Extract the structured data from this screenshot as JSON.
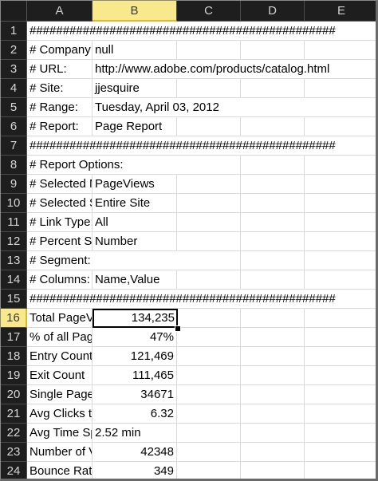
{
  "columns": [
    "A",
    "B",
    "C",
    "D",
    "E"
  ],
  "selected_cell": "B16",
  "rows": [
    {
      "num": "1",
      "a": "##############################################",
      "b": "",
      "span": true
    },
    {
      "num": "2",
      "a": "# Company:",
      "b": "null"
    },
    {
      "num": "3",
      "a": "# URL:",
      "b": "http://www.adobe.com/products/catalog.html"
    },
    {
      "num": "4",
      "a": "# Site:",
      "b": "jjesquire"
    },
    {
      "num": "5",
      "a": "# Range:",
      "b": "Tuesday, April 03, 2012"
    },
    {
      "num": "6",
      "a": "# Report:",
      "b": "Page Report"
    },
    {
      "num": "7",
      "a": "##############################################",
      "b": "",
      "span": true
    },
    {
      "num": "8",
      "a": "# Report Options:",
      "b": "",
      "spanA": true
    },
    {
      "num": "9",
      "a": "# Selected Metric:",
      "b": "PageViews"
    },
    {
      "num": "10",
      "a": "# Selected Segment:",
      "b": "Entire Site"
    },
    {
      "num": "11",
      "a": "# Link Type:",
      "b": "All"
    },
    {
      "num": "12",
      "a": "# Percent Shown as:",
      "b": "Number"
    },
    {
      "num": "13",
      "a": "# Segment:",
      "b": "",
      "spanA": true
    },
    {
      "num": "14",
      "a": "# Columns:",
      "b": "Name,Value"
    },
    {
      "num": "15",
      "a": "##############################################",
      "b": "",
      "span": true
    },
    {
      "num": "16",
      "a": "Total PageViews",
      "b": "134,235",
      "num_b": true
    },
    {
      "num": "17",
      "a": "% of all PageViews",
      "b": "47%",
      "num_b": true
    },
    {
      "num": "18",
      "a": "Entry Count",
      "b": "121,469",
      "num_b": true
    },
    {
      "num": "19",
      "a": "Exit Count",
      "b": "111,465",
      "num_b": true
    },
    {
      "num": "20",
      "a": "Single Page Visits",
      "b": "34671",
      "num_b": true
    },
    {
      "num": "21",
      "a": "Avg Clicks to Page",
      "b": "6.32",
      "num_b": true
    },
    {
      "num": "22",
      "a": "Avg Time Spent",
      "b": "2.52 min"
    },
    {
      "num": "23",
      "a": "Number of Visits",
      "b": "42348",
      "num_b": true
    },
    {
      "num": "24",
      "a": "Bounce Rate",
      "b": "349",
      "num_b": true
    }
  ]
}
